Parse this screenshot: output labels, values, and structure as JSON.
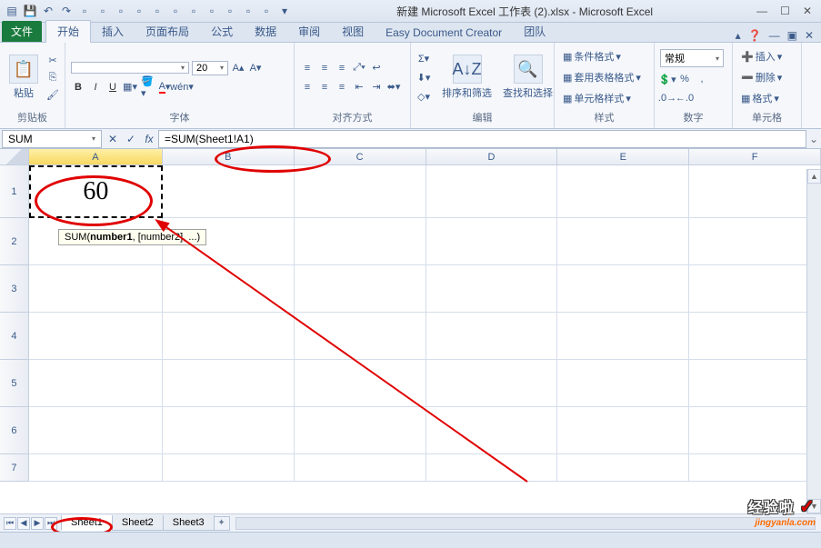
{
  "title": "新建 Microsoft Excel 工作表 (2).xlsx - Microsoft Excel",
  "tabs": {
    "file": "文件",
    "home": "开始",
    "insert": "插入",
    "layout": "页面布局",
    "formulas": "公式",
    "data": "数据",
    "review": "审阅",
    "view": "视图",
    "edc": "Easy Document Creator",
    "team": "团队"
  },
  "ribbon": {
    "clipboard": {
      "label": "剪贴板",
      "paste": "粘贴"
    },
    "font": {
      "label": "字体",
      "size": "20"
    },
    "align": {
      "label": "对齐方式"
    },
    "edit": {
      "label": "编辑",
      "sort": "排序和筛选",
      "find": "查找和选择"
    },
    "style": {
      "label": "样式",
      "cond": "条件格式",
      "tbl": "套用表格格式",
      "cell": "单元格样式"
    },
    "num": {
      "label": "数字",
      "fmt": "常规"
    },
    "cells": {
      "label": "单元格",
      "ins": "插入",
      "del": "删除",
      "fmt": "格式"
    }
  },
  "formula_bar": {
    "name": "SUM",
    "formula": "=SUM(Sheet1!A1)"
  },
  "grid": {
    "cols": [
      "A",
      "B",
      "C",
      "D",
      "E",
      "F"
    ],
    "rows": [
      "1",
      "2",
      "3",
      "4",
      "5",
      "6",
      "7"
    ],
    "A1": "60"
  },
  "tooltip": {
    "fn": "SUM(",
    "arg1": "number1",
    "rest": ", [number2], ...)"
  },
  "sheets": {
    "s1": "Sheet1",
    "s2": "Sheet2",
    "s3": "Sheet3"
  },
  "watermark": {
    "l1": "经验啦",
    "l2": "jingyanla.com"
  }
}
